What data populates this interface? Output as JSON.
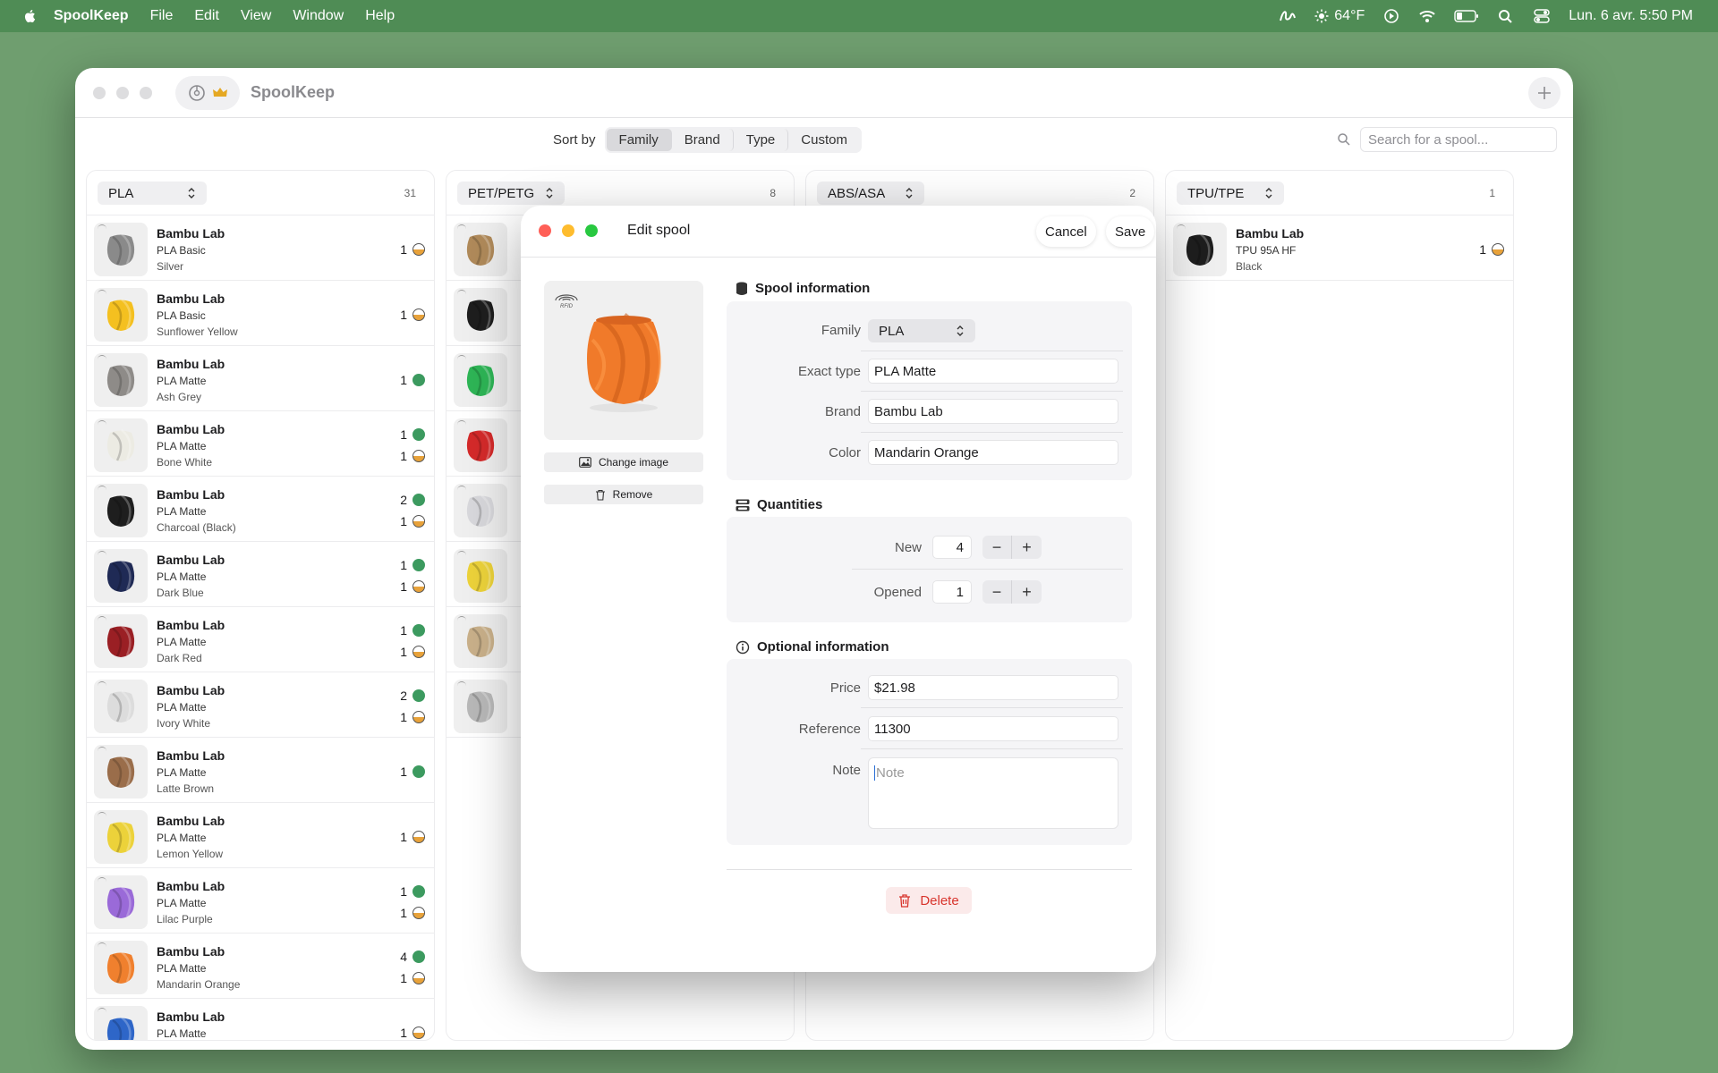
{
  "menubar": {
    "app_name": "SpoolKeep",
    "menus": [
      "File",
      "Edit",
      "View",
      "Window",
      "Help"
    ],
    "weather": "64°F",
    "datetime": "Lun. 6 avr.  5:50 PM"
  },
  "window": {
    "title": "SpoolKeep"
  },
  "toolbar": {
    "sort_label": "Sort by",
    "sort_options": [
      "Family",
      "Brand",
      "Type",
      "Custom"
    ],
    "active_sort": "Family",
    "search_placeholder": "Search for a spool..."
  },
  "columns": [
    {
      "family": "PLA",
      "count": "31",
      "spools": [
        {
          "brand": "Bambu Lab",
          "type": "PLA Basic",
          "color": "Silver",
          "hex": "#8a8a8a",
          "new": "",
          "opened": "1"
        },
        {
          "brand": "Bambu Lab",
          "type": "PLA Basic",
          "color": "Sunflower Yellow",
          "hex": "#f4c020",
          "new": "",
          "opened": "1"
        },
        {
          "brand": "Bambu Lab",
          "type": "PLA Matte",
          "color": "Ash Grey",
          "hex": "#8e8b88",
          "new": "1",
          "opened": ""
        },
        {
          "brand": "Bambu Lab",
          "type": "PLA Matte",
          "color": "Bone White",
          "hex": "#ecebe3",
          "new": "1",
          "opened": "1"
        },
        {
          "brand": "Bambu Lab",
          "type": "PLA Matte",
          "color": "Charcoal (Black)",
          "hex": "#1e1e1e",
          "new": "2",
          "opened": "1"
        },
        {
          "brand": "Bambu Lab",
          "type": "PLA Matte",
          "color": "Dark Blue",
          "hex": "#1f2a55",
          "new": "1",
          "opened": "1"
        },
        {
          "brand": "Bambu Lab",
          "type": "PLA Matte",
          "color": "Dark Red",
          "hex": "#9a1f24",
          "new": "1",
          "opened": "1"
        },
        {
          "brand": "Bambu Lab",
          "type": "PLA Matte",
          "color": "Ivory White",
          "hex": "#dcdcdc",
          "new": "2",
          "opened": "1"
        },
        {
          "brand": "Bambu Lab",
          "type": "PLA Matte",
          "color": "Latte Brown",
          "hex": "#9a6d4a",
          "new": "1",
          "opened": ""
        },
        {
          "brand": "Bambu Lab",
          "type": "PLA Matte",
          "color": "Lemon Yellow",
          "hex": "#ecd23a",
          "new": "",
          "opened": "1"
        },
        {
          "brand": "Bambu Lab",
          "type": "PLA Matte",
          "color": "Lilac Purple",
          "hex": "#9a6ad8",
          "new": "1",
          "opened": "1"
        },
        {
          "brand": "Bambu Lab",
          "type": "PLA Matte",
          "color": "Mandarin Orange",
          "hex": "#f0802e",
          "new": "4",
          "opened": "1"
        },
        {
          "brand": "Bambu Lab",
          "type": "PLA Matte",
          "color": "",
          "hex": "#2e66c8",
          "new": "",
          "opened": "1"
        }
      ]
    },
    {
      "family": "PET/PETG",
      "count": "8",
      "spools": [
        {
          "brand": "",
          "type": "",
          "color": "",
          "hex": "#b08a5a",
          "new": "",
          "opened": ""
        },
        {
          "brand": "",
          "type": "",
          "color": "",
          "hex": "#1e1e1e",
          "new": "",
          "opened": ""
        },
        {
          "brand": "",
          "type": "",
          "color": "",
          "hex": "#2eb556",
          "new": "",
          "opened": ""
        },
        {
          "brand": "",
          "type": "",
          "color": "",
          "hex": "#d42a2a",
          "new": "",
          "opened": ""
        },
        {
          "brand": "",
          "type": "",
          "color": "",
          "hex": "#d8d8dc",
          "new": "",
          "opened": ""
        },
        {
          "brand": "",
          "type": "",
          "color": "",
          "hex": "#ecd23a",
          "new": "",
          "opened": ""
        },
        {
          "brand": "",
          "type": "",
          "color": "",
          "hex": "#c9b08a",
          "new": "",
          "opened": ""
        },
        {
          "brand": "",
          "type": "",
          "color": "",
          "hex": "#b8b8b8",
          "new": "",
          "opened": ""
        }
      ]
    },
    {
      "family": "ABS/ASA",
      "count": "2",
      "spools": []
    },
    {
      "family": "TPU/TPE",
      "count": "1",
      "spools": [
        {
          "brand": "Bambu Lab",
          "type": "TPU 95A HF",
          "color": "Black",
          "hex": "#1e1e1e",
          "new": "",
          "opened": "1"
        }
      ]
    }
  ],
  "dialog": {
    "title": "Edit spool",
    "cancel": "Cancel",
    "save": "Save",
    "image_badge": "RFID",
    "change_image": "Change image",
    "remove": "Remove",
    "spool_info": {
      "title": "Spool information",
      "family_label": "Family",
      "family_value": "PLA",
      "exact_type_label": "Exact type",
      "exact_type_value": "PLA Matte",
      "brand_label": "Brand",
      "brand_value": "Bambu Lab",
      "color_label": "Color",
      "color_value": "Mandarin Orange"
    },
    "quantities": {
      "title": "Quantities",
      "new_label": "New",
      "new_value": "4",
      "opened_label": "Opened",
      "opened_value": "1",
      "minus": "−",
      "plus": "+"
    },
    "optional": {
      "title": "Optional information",
      "price_label": "Price",
      "price_value": "$21.98",
      "reference_label": "Reference",
      "reference_value": "11300",
      "note_label": "Note",
      "note_placeholder": "Note"
    },
    "delete": "Delete"
  },
  "colors": {
    "desktop": "#6f9e6f",
    "menubar": "#4f8c55",
    "new_dot": "#3c9a5f",
    "opened_fill": "#e8a23a",
    "delete": "#d8342c",
    "close": "#ff5f57",
    "minimize": "#febc2e",
    "zoom": "#28c840"
  }
}
